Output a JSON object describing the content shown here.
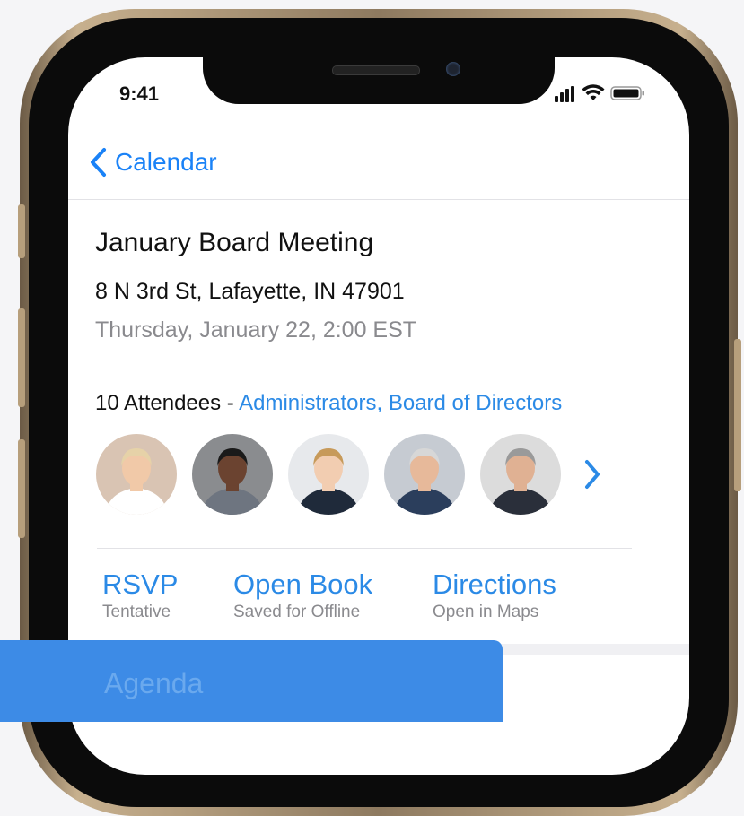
{
  "status_bar": {
    "time": "9:41"
  },
  "nav": {
    "back_label": "Calendar"
  },
  "event": {
    "title": "January Board Meeting",
    "address": "8 N 3rd St, Lafayette, IN 47901",
    "datetime": "Thursday, January 22, 2:00 EST"
  },
  "attendees": {
    "count_label": "10 Attendees - ",
    "groups": "Administrators, Board of Directors",
    "avatars": [
      {
        "name": "attendee-1",
        "hair": "#e6d2a8",
        "skin": "#f1c9a8",
        "shirt": "#ffffff",
        "bg": "#d9c4b3"
      },
      {
        "name": "attendee-2",
        "hair": "#1a1a1a",
        "skin": "#6b4330",
        "shirt": "#6e7580",
        "bg": "#8a8c8f"
      },
      {
        "name": "attendee-3",
        "hair": "#c79a5a",
        "skin": "#f2cdb1",
        "shirt": "#1f2a3a",
        "bg": "#e7e9ec"
      },
      {
        "name": "attendee-4",
        "hair": "#d7d7d7",
        "skin": "#e7b99a",
        "shirt": "#2b3e5c",
        "bg": "#c6cbd2"
      },
      {
        "name": "attendee-5",
        "hair": "#9a9a9a",
        "skin": "#e0b193",
        "shirt": "#2a2f3a",
        "bg": "#dcdcdc"
      }
    ]
  },
  "actions": [
    {
      "label": "RSVP",
      "sub": "Tentative"
    },
    {
      "label": "Open Book",
      "sub": "Saved for Offline"
    },
    {
      "label": "Directions",
      "sub": "Open in Maps"
    }
  ],
  "agenda": {
    "label": "Agenda"
  },
  "colors": {
    "accent": "#2b8ae6",
    "panel": "#3d8be6"
  },
  "icons": [
    "chevron-left-icon",
    "chevron-right-icon",
    "signal-icon",
    "wifi-icon",
    "battery-icon"
  ]
}
